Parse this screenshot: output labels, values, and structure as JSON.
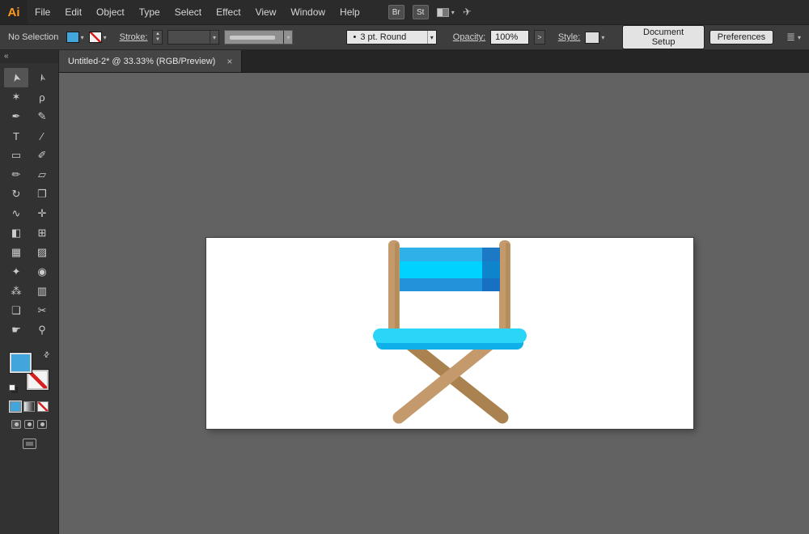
{
  "menubar": {
    "logo": "Ai",
    "items": [
      "File",
      "Edit",
      "Object",
      "Type",
      "Select",
      "Effect",
      "View",
      "Window",
      "Help"
    ],
    "br_label": "Br",
    "st_label": "St",
    "workspace_chevron": "▾",
    "share_glyph": "✈"
  },
  "controlbar": {
    "no_selection": "No Selection",
    "fill_chevron": "▾",
    "stroke_chevron": "▾",
    "stroke_label": "Stroke:",
    "stepper_up": "▲",
    "stepper_down": "▼",
    "brush_bullet": "•",
    "brush_value": "3 pt. Round",
    "opacity_label": "Opacity:",
    "opacity_value": "100%",
    "opacity_expand": ">",
    "style_label": "Style:",
    "document_setup_label": "Document Setup",
    "preferences_label": "Preferences",
    "align_glyph": "≣",
    "align_chevron": "▾"
  },
  "tab": {
    "title": "Untitled-2* @ 33.33% (RGB/Preview)",
    "close_label": "×"
  },
  "toolbar": {
    "collapse_label": "«",
    "swap_glyph": "⇄",
    "tools": [
      {
        "name": "selection",
        "glyph": "➤"
      },
      {
        "name": "direct-selection",
        "glyph": "➣"
      },
      {
        "name": "magic-wand",
        "glyph": "✶"
      },
      {
        "name": "lasso",
        "glyph": "ρ"
      },
      {
        "name": "pen",
        "glyph": "✒"
      },
      {
        "name": "curvature",
        "glyph": "✎"
      },
      {
        "name": "type",
        "glyph": "T"
      },
      {
        "name": "line-segment",
        "glyph": "∕"
      },
      {
        "name": "rectangle",
        "glyph": "▭"
      },
      {
        "name": "paintbrush",
        "glyph": "✐"
      },
      {
        "name": "pencil",
        "glyph": "✏"
      },
      {
        "name": "eraser",
        "glyph": "▱"
      },
      {
        "name": "rotate",
        "glyph": "↻"
      },
      {
        "name": "scale",
        "glyph": "❐"
      },
      {
        "name": "width",
        "glyph": "∿"
      },
      {
        "name": "free-transform",
        "glyph": "✛"
      },
      {
        "name": "shape-builder",
        "glyph": "◧"
      },
      {
        "name": "perspective-grid",
        "glyph": "⊞"
      },
      {
        "name": "mesh",
        "glyph": "▦"
      },
      {
        "name": "gradient",
        "glyph": "▨"
      },
      {
        "name": "eyedropper",
        "glyph": "✦"
      },
      {
        "name": "blend",
        "glyph": "◉"
      },
      {
        "name": "symbol-sprayer",
        "glyph": "⁂"
      },
      {
        "name": "column-graph",
        "glyph": "▥"
      },
      {
        "name": "artboard",
        "glyph": "❏"
      },
      {
        "name": "slice",
        "glyph": "✂"
      },
      {
        "name": "hand",
        "glyph": "☛"
      },
      {
        "name": "zoom",
        "glyph": "⚲"
      }
    ]
  },
  "colors": {
    "fill_blue": "#42a6dc",
    "stroke_none_red": "#d81e1e"
  },
  "artwork": {
    "description": "director chair illustration",
    "wood": "#c49a6c",
    "wood_dark": "#a9824f",
    "stripe_top": "#2fb0e6",
    "stripe_mid": "#00d2ff",
    "stripe_bottom": "#2492da",
    "band_dark": "#1463b8",
    "seat_top": "#2bd5f8",
    "seat_bottom": "#0fb0ea"
  }
}
